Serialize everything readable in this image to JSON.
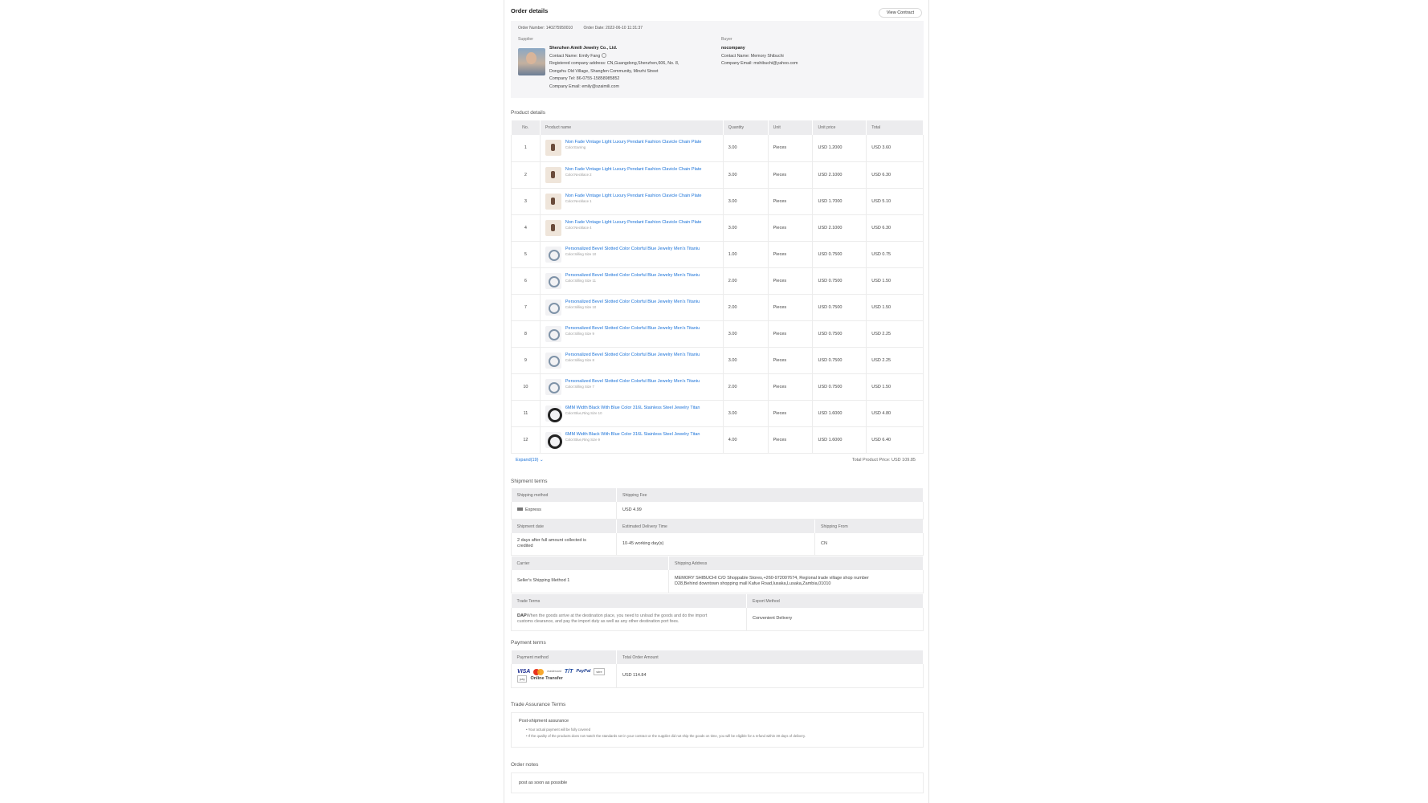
{
  "header": {
    "title": "Order details",
    "view_contract": "View Contract"
  },
  "order": {
    "number_label": "Order Number: 140275950010",
    "date_label": "Order Date: 2022-06-10 11:31:37"
  },
  "supplier": {
    "label": "Supplier",
    "company": "Shenzhen Aimili Jewelry Co., Ltd.",
    "contact": "Contact Name: Emily Fang",
    "address1": "Registered company address: CN,Guangdong,Shenzhen,606, No. 8,",
    "address2": "Dongzhu Old Village, Shangfen Community, Minzhi Street",
    "tel": "Company Tel: 86-0755-15858985852",
    "email": "Company Email: emily@szaimili.com"
  },
  "buyer": {
    "label": "Buyer",
    "company": "nocompany",
    "contact": "Contact Name: Memory Shibuchi",
    "email": "Company Email: mshibuchi@yahoo.com"
  },
  "products": {
    "title": "Product details",
    "columns": [
      "No.",
      "Product name",
      "Quantity",
      "Unit",
      "Unit price",
      "Total"
    ],
    "rows": [
      {
        "no": "1",
        "name": "Non Fade Vintage Light Luxury Pendant Fashion Clavicle Chain Plate",
        "variant": "Color:Earring",
        "qty": "3.00",
        "unit": "Pieces",
        "price": "USD 1.2000",
        "total": "USD 3.60",
        "thumb": "t0"
      },
      {
        "no": "2",
        "name": "Non Fade Vintage Light Luxury Pendant Fashion Clavicle Chain Plate",
        "variant": "Color:Necklace 2",
        "qty": "3.00",
        "unit": "Pieces",
        "price": "USD 2.1000",
        "total": "USD 6.30",
        "thumb": "t0"
      },
      {
        "no": "3",
        "name": "Non Fade Vintage Light Luxury Pendant Fashion Clavicle Chain Plate",
        "variant": "Color:Necklace 1",
        "qty": "3.00",
        "unit": "Pieces",
        "price": "USD 1.7000",
        "total": "USD 5.10",
        "thumb": "t0"
      },
      {
        "no": "4",
        "name": "Non Fade Vintage Light Luxury Pendant Fashion Clavicle Chain Plate",
        "variant": "Color:Necklace 4",
        "qty": "3.00",
        "unit": "Pieces",
        "price": "USD 2.1000",
        "total": "USD 6.30",
        "thumb": "t0"
      },
      {
        "no": "5",
        "name": "Personalized Bevel Slotted Color Colorful Blue Jewelry Men's Titaniu",
        "variant": "Color:Silling Size 10",
        "qty": "1.00",
        "unit": "Pieces",
        "price": "USD 0.7500",
        "total": "USD 0.75",
        "thumb": "t1"
      },
      {
        "no": "6",
        "name": "Personalized Bevel Slotted Color Colorful Blue Jewelry Men's Titaniu",
        "variant": "Color:Silling Size 11",
        "qty": "2.00",
        "unit": "Pieces",
        "price": "USD 0.7500",
        "total": "USD 1.50",
        "thumb": "t1"
      },
      {
        "no": "7",
        "name": "Personalized Bevel Slotted Color Colorful Blue Jewelry Men's Titaniu",
        "variant": "Color:Silling Size 10",
        "qty": "2.00",
        "unit": "Pieces",
        "price": "USD 0.7500",
        "total": "USD 1.50",
        "thumb": "t1"
      },
      {
        "no": "8",
        "name": "Personalized Bevel Slotted Color Colorful Blue Jewelry Men's Titaniu",
        "variant": "Color:Silling Size 9",
        "qty": "3.00",
        "unit": "Pieces",
        "price": "USD 0.7500",
        "total": "USD 2.25",
        "thumb": "t1"
      },
      {
        "no": "9",
        "name": "Personalized Bevel Slotted Color Colorful Blue Jewelry Men's Titaniu",
        "variant": "Color:Silling Size 8",
        "qty": "3.00",
        "unit": "Pieces",
        "price": "USD 0.7500",
        "total": "USD 2.25",
        "thumb": "t1"
      },
      {
        "no": "10",
        "name": "Personalized Bevel Slotted Color Colorful Blue Jewelry Men's Titaniu",
        "variant": "Color:Silling Size 7",
        "qty": "2.00",
        "unit": "Pieces",
        "price": "USD 0.7500",
        "total": "USD 1.50",
        "thumb": "t1"
      },
      {
        "no": "11",
        "name": "6MM Width Black With Blue Color 316L Stainless Steel Jewelry Titan",
        "variant": "Color:Blue,Ring Size 10",
        "qty": "3.00",
        "unit": "Pieces",
        "price": "USD 1.6000",
        "total": "USD 4.80",
        "thumb": "t2"
      },
      {
        "no": "12",
        "name": "6MM Width Black With Blue Color 316L Stainless Steel Jewelry Titan",
        "variant": "Color:Blue,Ring Size 9",
        "qty": "4.00",
        "unit": "Pieces",
        "price": "USD 1.6000",
        "total": "USD 6.40",
        "thumb": "t2"
      }
    ],
    "expand": "Expand(19)",
    "total_label": "Total Product Price: USD 109.85"
  },
  "shipment": {
    "title": "Shipment terms",
    "method_h": "Shipping method",
    "fee_h": "Shipping Fee",
    "method": "Express",
    "fee": "USD 4.99",
    "date_h": "Shipment date",
    "eta_h": "Estimated Delivery Time",
    "from_h": "Shipping From",
    "date1": "2 days after full amount collected is",
    "date2": "credited",
    "eta": "10-45 working day(s)",
    "from": "CN",
    "carrier_h": "Carrier",
    "addr_h": "Shipping Address",
    "carrier": "Seller's Shipping Method 1",
    "addr1": "MEMORY SHIBUCHI C/O Shoppable Stores,+260-972007674, Regional trade village shop number",
    "addr2": "D28,Behind downtown shopping mall Kafue Road,lusaka,Lusaka,Zambia,01010",
    "trade_h": "Trade Terms",
    "export_h": "Export Method",
    "trade_code": "DAP",
    "trade1": "When the goods arrive at the destination place, you need to unload the goods and do the import",
    "trade2": "customs clearance, and pay the import duty as well as any other destination port fees.",
    "export": "Convenient Delivery"
  },
  "payment": {
    "title": "Payment terms",
    "method_h": "Payment method",
    "total_h": "Total Order Amount",
    "logos": {
      "visa": "VISA",
      "mc_text": "mastercard",
      "tt": "T/T",
      "paypal": "PayPal",
      "wire": "wire",
      "tiny2": "pay"
    },
    "online": "Online Transfer",
    "total": "USD 114.84"
  },
  "assurance": {
    "title": "Trade Assurance Terms",
    "head": "Post-shipment assurance",
    "b1": "Your actual payment will be fully covered",
    "b2": "If the quality of the products does not match the standards set in your contract or the supplier did not ship the goods on time, you will be eligible for a refund within 30 days of delivery."
  },
  "notes": {
    "title": "Order notes",
    "text": "post as soon as possible"
  },
  "colors": {
    "link": "#1a72d8",
    "header_bg": "#ececee",
    "panel_bg": "#f5f5f7"
  }
}
